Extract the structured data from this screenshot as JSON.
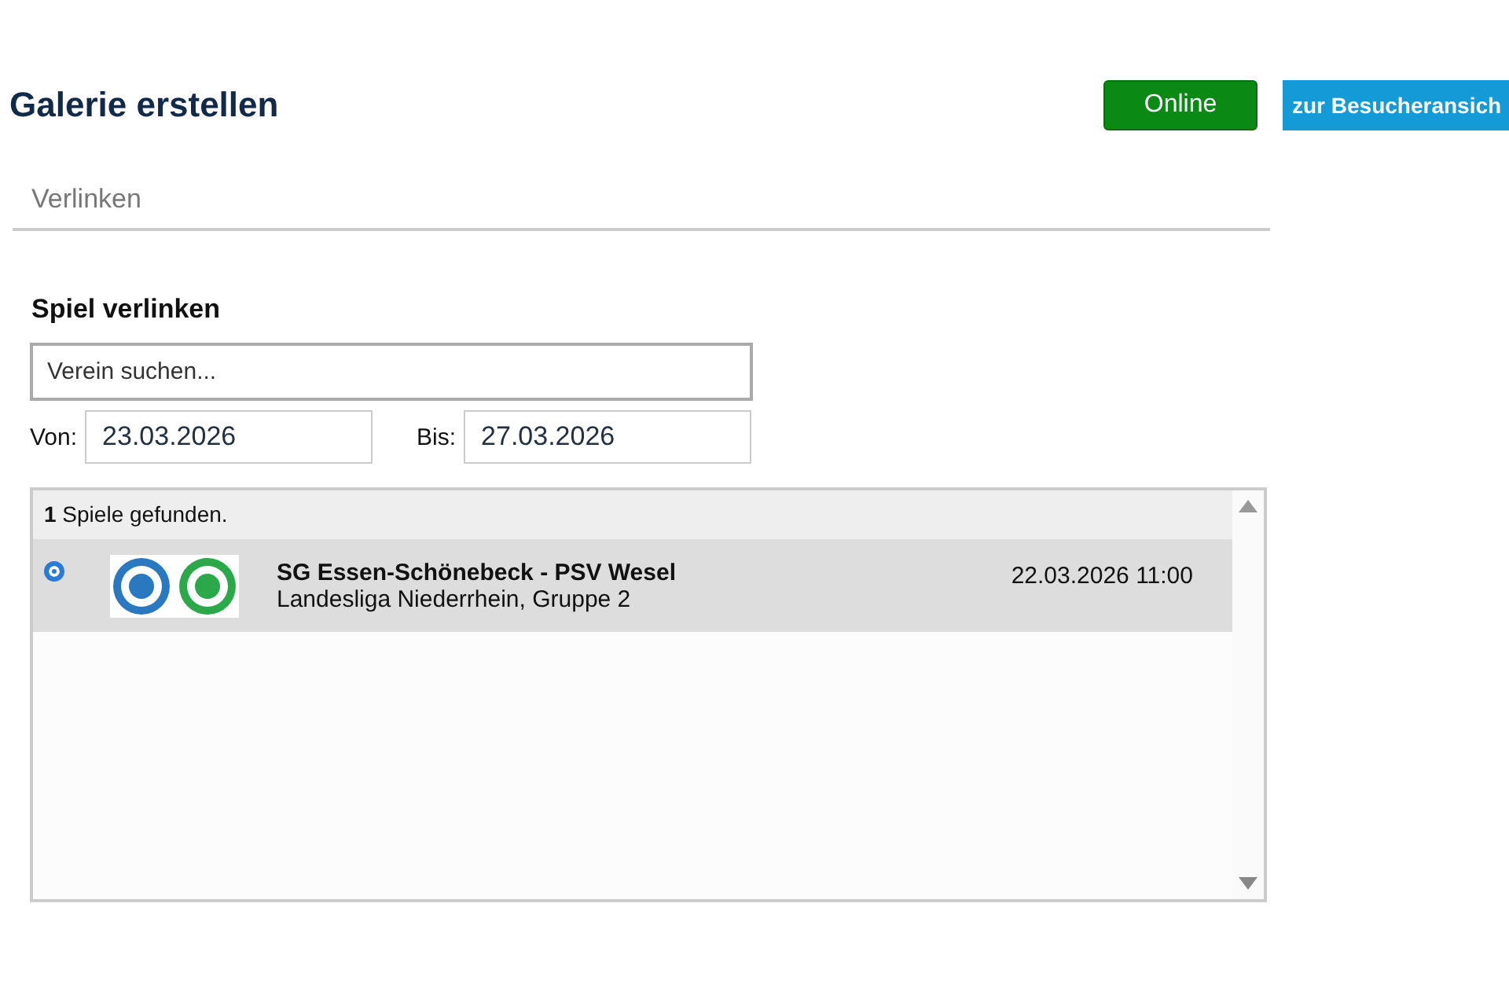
{
  "header": {
    "title": "Galerie erstellen",
    "status_button": "Online",
    "visitor_button": "zur Besucheransich"
  },
  "section": {
    "title": "Verlinken"
  },
  "link_game": {
    "title": "Spiel verlinken",
    "search": {
      "placeholder": "Verein suchen..."
    },
    "from": {
      "label": "Von:",
      "value": "23.03.2026"
    },
    "to": {
      "label": "Bis:",
      "value": "27.03.2026"
    },
    "results": {
      "count": "1",
      "count_text": " Spiele gefunden.",
      "games": [
        {
          "selected": true,
          "teams": "SG Essen-Schönebeck - PSV Wesel",
          "league": "Landesliga Niederrhein, Gruppe 2",
          "datetime": "22.03.2026 11:00",
          "crests": [
            {
              "color": "#2a78c0"
            },
            {
              "color": "#2aa84a"
            }
          ]
        }
      ]
    }
  }
}
